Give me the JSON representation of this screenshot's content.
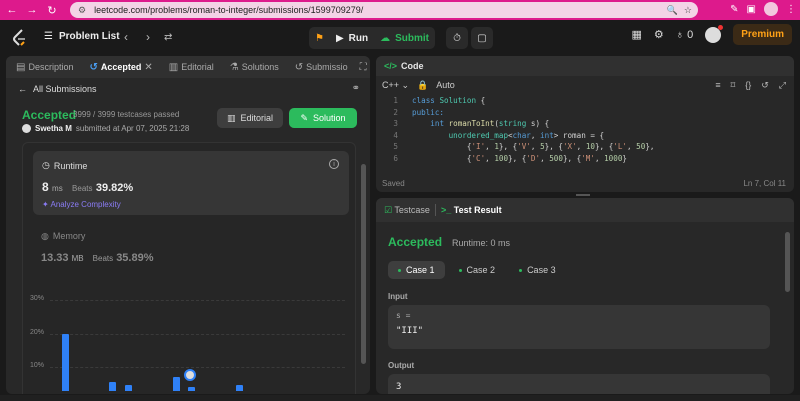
{
  "browser": {
    "url": "leetcode.com/problems/roman-to-integer/submissions/1599709279/"
  },
  "topbar": {
    "problem_list": "Problem List",
    "run": "Run",
    "submit": "Submit",
    "streak": "0",
    "premium": "Premium"
  },
  "left_tabs": [
    {
      "label": "Description"
    },
    {
      "label": "Accepted"
    },
    {
      "label": "Editorial"
    },
    {
      "label": "Solutions"
    },
    {
      "label": "Submissio"
    }
  ],
  "submission": {
    "all_submissions": "All Submissions",
    "status": "Accepted",
    "testcases": "3999 / 3999 testcases passed",
    "user": "Swetha M",
    "submitted_at": "submitted at Apr 07, 2025 21:28",
    "editorial_btn": "Editorial",
    "solution_btn": "Solution"
  },
  "runtime": {
    "label": "Runtime",
    "value": "8",
    "unit": "ms",
    "beats_label": "Beats",
    "beats": "39.82%",
    "analyze": "Analyze Complexity"
  },
  "memory": {
    "label": "Memory",
    "value": "13.33",
    "unit": "MB",
    "beats_label": "Beats",
    "beats": "35.89%"
  },
  "chart_data": {
    "type": "bar",
    "y_ticks": [
      "30%",
      "20%",
      "10%"
    ],
    "ylim": [
      0,
      30
    ],
    "values": [
      20,
      0,
      0,
      5.5,
      4.5,
      1.5,
      1.5,
      7,
      4,
      1.5,
      1.5,
      4.5,
      1.5
    ]
  },
  "code": {
    "title": "Code",
    "language": "C++",
    "mode": "Auto",
    "status": "Saved",
    "cursor": "Ln 7, Col 11",
    "lines": [
      "1",
      "2",
      "3",
      "4",
      "5",
      "6"
    ]
  },
  "test": {
    "testcase_tab": "Testcase",
    "result_tab": "Test Result",
    "status": "Accepted",
    "runtime": "Runtime: 0 ms",
    "cases": [
      "Case 1",
      "Case 2",
      "Case 3"
    ],
    "input_label": "Input",
    "input_var": "s =",
    "input_value": "\"III\"",
    "output_label": "Output",
    "output_value": "3"
  },
  "colors": {
    "accent_green": "#2cbb5d",
    "bar_blue": "#2f81f7",
    "premium": "#ffa116",
    "browser": "#dd1a8c"
  }
}
